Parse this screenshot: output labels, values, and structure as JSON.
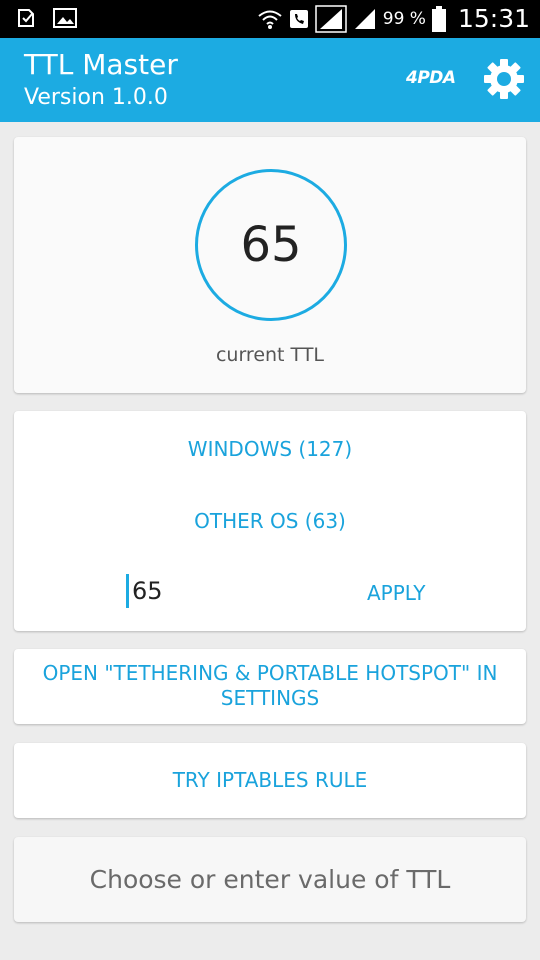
{
  "status_bar": {
    "battery_text": "99 %",
    "time": "15:31",
    "icons": [
      "download-done-icon",
      "image-icon",
      "wifi-icon",
      "phone-icon",
      "signal-icon",
      "signal-icon",
      "battery-icon"
    ]
  },
  "app_bar": {
    "title": "TTL Master",
    "version": "Version 1.0.0",
    "logo_text": "4PDA",
    "settings_icon": "gear-icon",
    "color": "#1cabe2"
  },
  "ttl_card": {
    "current_value": "65",
    "caption": "current TTL"
  },
  "presets": {
    "windows_label": "WINDOWS (127)",
    "other_os_label": "OTHER OS (63)",
    "input_value": "65",
    "apply_label": "APPLY"
  },
  "actions": {
    "open_tethering_label": "OPEN \"TETHERING & PORTABLE HOTSPOT\" IN SETTINGS",
    "iptables_label": "TRY IPTABLES RULE"
  },
  "hint": {
    "text": "Choose or enter value of TTL"
  },
  "colors": {
    "accent": "#1cabe2",
    "link": "#1aa3dc",
    "background": "#ececec"
  }
}
